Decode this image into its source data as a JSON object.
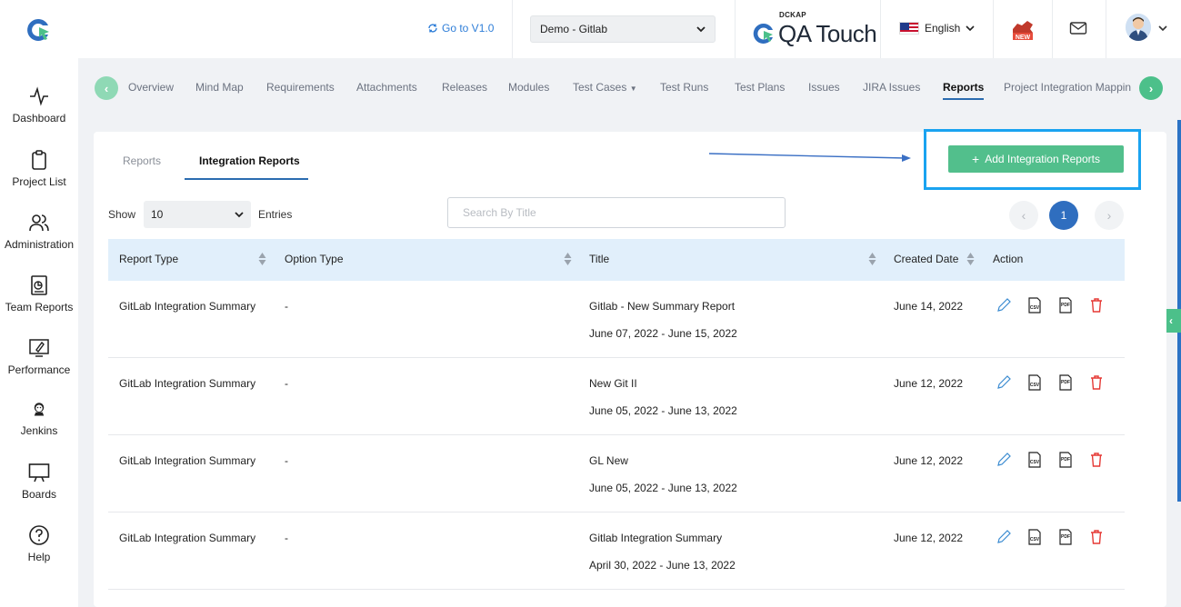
{
  "header": {
    "goto_label": "Go to V1.0",
    "project_select": "Demo - Gitlab",
    "brand_top": "DCKAP",
    "brand_name": "QA Touch",
    "language": "English",
    "new_badge": "NEW"
  },
  "sidebar": {
    "items": [
      {
        "label": "Dashboard",
        "icon": "activity-icon"
      },
      {
        "label": "Project List",
        "icon": "clipboard-icon"
      },
      {
        "label": "Administration",
        "icon": "users-icon"
      },
      {
        "label": "Team Reports",
        "icon": "report-icon"
      },
      {
        "label": "Performance",
        "icon": "rocket-icon"
      },
      {
        "label": "Jenkins",
        "icon": "jenkins-icon"
      },
      {
        "label": "Boards",
        "icon": "board-icon"
      },
      {
        "label": "Help",
        "icon": "help-icon"
      }
    ]
  },
  "tabs": [
    "Overview",
    "Mind Map",
    "Requirements",
    "Attachments",
    "Releases",
    "Modules",
    "Test Cases",
    "Test Runs",
    "Test Plans",
    "Issues",
    "JIRA Issues",
    "Reports",
    "Project Integration Mappin"
  ],
  "active_tab": "Reports",
  "subtabs": [
    "Reports",
    "Integration Reports"
  ],
  "active_subtab": "Integration Reports",
  "add_button": "Add Integration Reports",
  "table_controls": {
    "show_label": "Show",
    "entries_value": "10",
    "entries_label": "Entries",
    "search_placeholder": "Search By Title",
    "current_page": "1"
  },
  "table": {
    "columns": [
      "Report Type",
      "Option Type",
      "Title",
      "Created Date",
      "Action"
    ],
    "rows": [
      {
        "report_type": "GitLab Integration Summary",
        "option_type": "-",
        "title": "Gitlab - New Summary Report",
        "range": "June 07, 2022 - June 15, 2022",
        "created": "June 14, 2022"
      },
      {
        "report_type": "GitLab Integration Summary",
        "option_type": "-",
        "title": "New Git II",
        "range": "June 05, 2022 - June 13, 2022",
        "created": "June 12, 2022"
      },
      {
        "report_type": "GitLab Integration Summary",
        "option_type": "-",
        "title": "GL New",
        "range": "June 05, 2022 - June 13, 2022",
        "created": "June 12, 2022"
      },
      {
        "report_type": "GitLab Integration Summary",
        "option_type": "-",
        "title": "Gitlab Integration Summary",
        "range": "April 30, 2022 - June 13, 2022",
        "created": "June 12, 2022"
      }
    ]
  },
  "colors": {
    "accent_green": "#52bf8c",
    "accent_blue": "#2f6ebf",
    "highlight": "#1aa3f0",
    "delete_red": "#e53935"
  }
}
